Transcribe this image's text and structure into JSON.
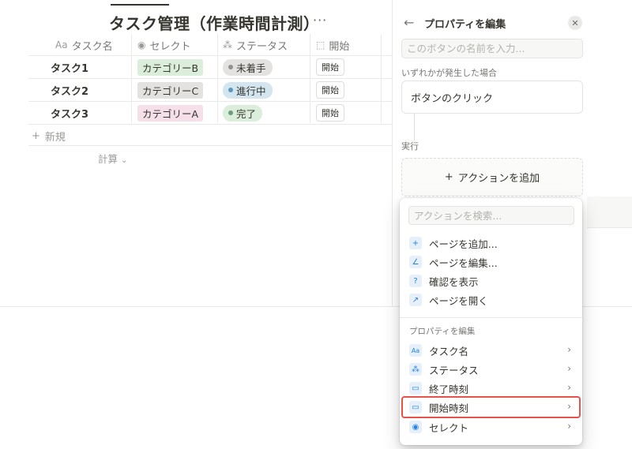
{
  "database": {
    "title": "タスク管理（作業時間計測）",
    "more": "···",
    "columns": [
      {
        "label": "タスク名",
        "icon": "Aa"
      },
      {
        "label": "セレクト",
        "icon": "◉"
      },
      {
        "label": "ステータス",
        "icon": "⁂"
      },
      {
        "label": "開始",
        "icon": "⬚"
      }
    ],
    "rows": [
      {
        "name": "タスク1",
        "select": "カテゴリーB",
        "select_color": "#dbeddb",
        "status": "未着手",
        "status_bg": "#e3e2e0",
        "status_dot": "#91918e",
        "start_button": "開始"
      },
      {
        "name": "タスク2",
        "select": "カテゴリーC",
        "select_color": "#e3e2e0",
        "status": "進行中",
        "status_bg": "#d3e5ef",
        "status_dot": "#5b97bd",
        "start_button": "開始"
      },
      {
        "name": "タスク3",
        "select": "カテゴリーA",
        "select_color": "#f5e0e9",
        "status": "完了",
        "status_bg": "#dbeddb",
        "status_dot": "#6c9b7d",
        "start_button": "開始"
      }
    ],
    "new_row": "新規",
    "calculate": "計算"
  },
  "panel": {
    "title": "プロパティを編集",
    "name_placeholder": "このボタンの名前を入力...",
    "trigger_label": "いずれかが発生した場合",
    "trigger_value": "ボタンのクリック",
    "action_label": "実行",
    "add_action": "アクションを追加"
  },
  "dropdown": {
    "search_placeholder": "アクションを検索...",
    "actions": [
      {
        "label": "ページを追加...",
        "icon": "+"
      },
      {
        "label": "ページを編集...",
        "icon": "∠"
      },
      {
        "label": "確認を表示",
        "icon": "?"
      },
      {
        "label": "ページを開く",
        "icon": "↗"
      }
    ],
    "section_title": "プロパティを編集",
    "properties": [
      {
        "label": "タスク名",
        "icon": "Aa",
        "highlighted": false
      },
      {
        "label": "ステータス",
        "icon": "⁂",
        "highlighted": false
      },
      {
        "label": "終了時刻",
        "icon": "▭",
        "highlighted": false
      },
      {
        "label": "開始時刻",
        "icon": "▭",
        "highlighted": true
      },
      {
        "label": "セレクト",
        "icon": "◉",
        "highlighted": false
      }
    ]
  },
  "colors": {
    "accent": "#2383e2",
    "highlight_border": "#e5534b"
  }
}
